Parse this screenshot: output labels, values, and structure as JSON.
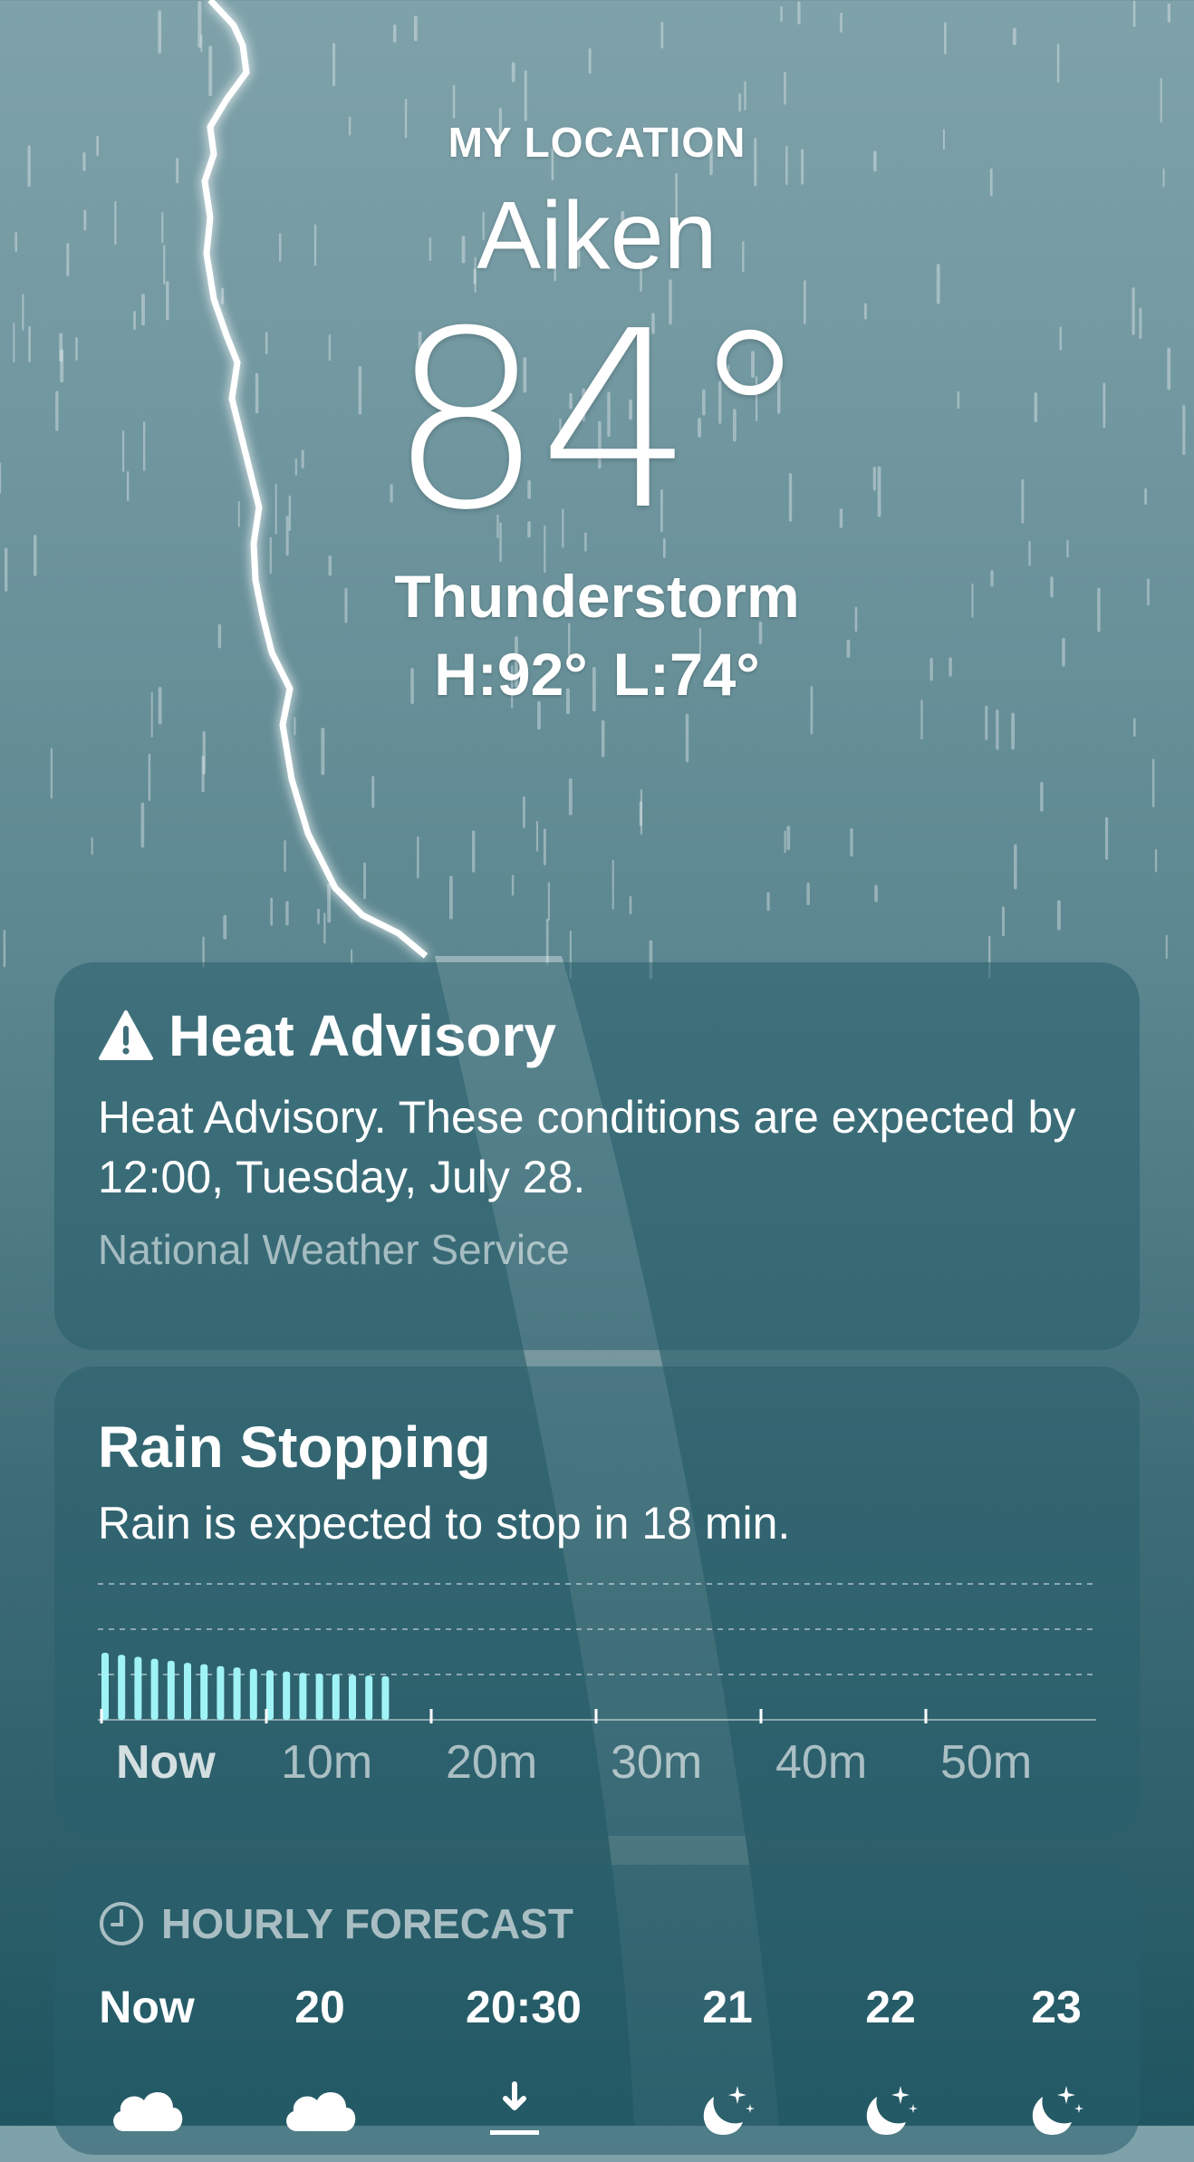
{
  "location_label": "MY LOCATION",
  "city": "Aiken",
  "temperature": "84°",
  "condition": "Thunderstorm",
  "high": "H:92°",
  "low": "L:74°",
  "advisory": {
    "icon": "warning-triangle-icon",
    "title": "Heat Advisory",
    "body": "Heat Advisory. These conditions are expected by 12:00, Tuesday, July 28.",
    "source": "National Weather Service"
  },
  "rain": {
    "title": "Rain Stopping",
    "description": "Rain is expected to stop in 18 min.",
    "axis_labels": [
      "Now",
      "10m",
      "20m",
      "30m",
      "40m",
      "50m"
    ],
    "bar_color": "#9ff3f6"
  },
  "chart_data": {
    "type": "bar",
    "title": "",
    "x_unit": "minutes from now",
    "categories": [
      0,
      1,
      2,
      3,
      4,
      5,
      6,
      7,
      8,
      9,
      10,
      11,
      12,
      13,
      14,
      15,
      16,
      17
    ],
    "values": [
      1.0,
      0.97,
      0.94,
      0.91,
      0.88,
      0.85,
      0.83,
      0.8,
      0.78,
      0.76,
      0.74,
      0.72,
      0.7,
      0.69,
      0.68,
      0.67,
      0.66,
      0.65
    ],
    "tick_labels": [
      "Now",
      "10m",
      "20m",
      "30m",
      "40m",
      "50m"
    ],
    "ylim": [
      0,
      1
    ],
    "grid": true
  },
  "hourly": {
    "label": "HOURLY FORECAST",
    "icon": "clock-icon",
    "hours": [
      {
        "time": "Now",
        "icon": "cloud-icon"
      },
      {
        "time": "20",
        "icon": "cloud-icon"
      },
      {
        "time": "20:30",
        "icon": "sunset-icon"
      },
      {
        "time": "21",
        "icon": "moon-stars-icon"
      },
      {
        "time": "22",
        "icon": "moon-stars-icon"
      },
      {
        "time": "23",
        "icon": "moon-stars-icon"
      }
    ]
  }
}
